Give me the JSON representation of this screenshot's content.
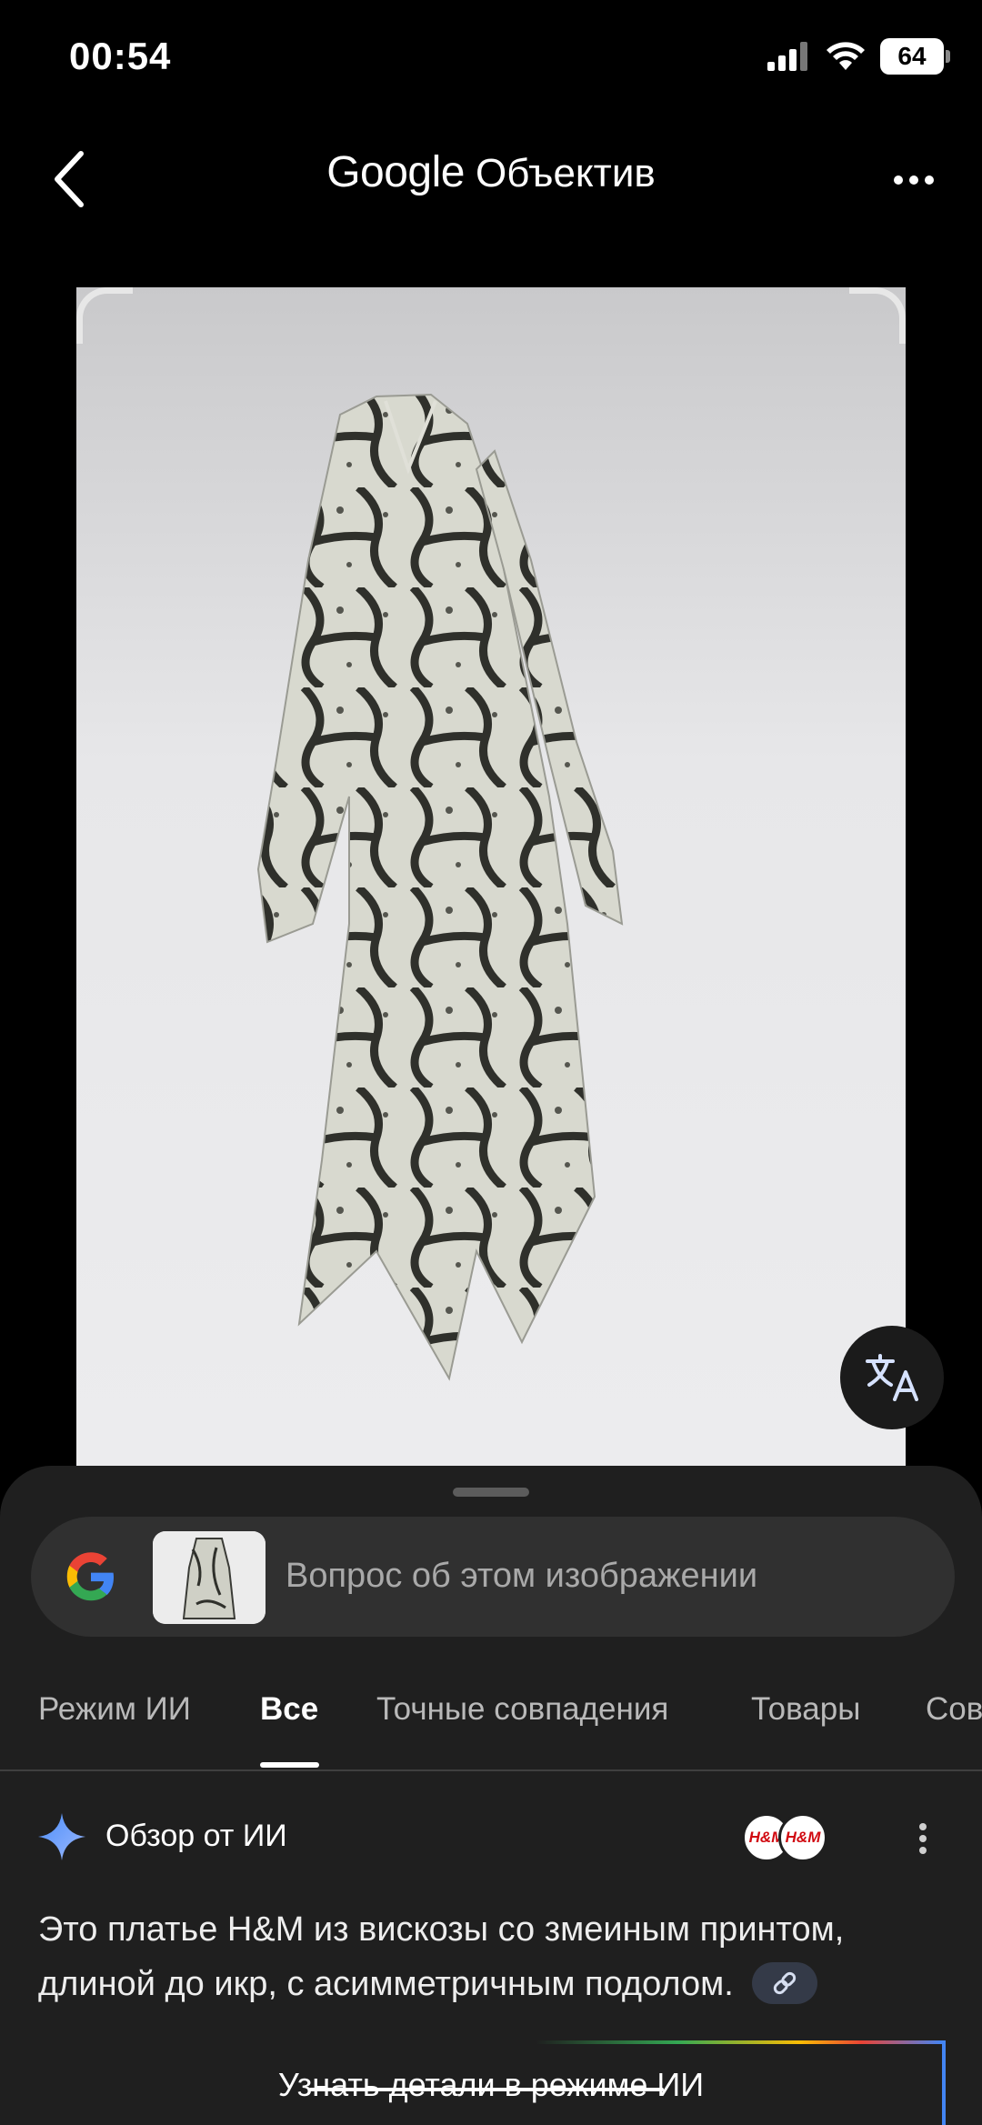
{
  "status_bar": {
    "time": "00:54",
    "battery": "64"
  },
  "header": {
    "brand": "Google",
    "title": "Объектив"
  },
  "image": {
    "description_icon": "dress-image"
  },
  "search": {
    "placeholder": "Вопрос об этом изображении"
  },
  "tabs": [
    {
      "label": "Режим ИИ"
    },
    {
      "label": "Все"
    },
    {
      "label": "Точные совпадения"
    },
    {
      "label": "Товары"
    },
    {
      "label": "Сов"
    }
  ],
  "overview": {
    "title": "Обзор от ИИ",
    "source_logo": "H&M",
    "text": "Это платье H&M из вискозы со змеиным принтом, длиной до икр, с асимметричным подолом."
  },
  "ai_mode_button": {
    "label": "Узнать детали в режиме ИИ"
  },
  "colors": {
    "background": "#000000",
    "sheet": "#1f1f1f",
    "search_bar": "#303030",
    "accent_blue": "#4285f4"
  }
}
